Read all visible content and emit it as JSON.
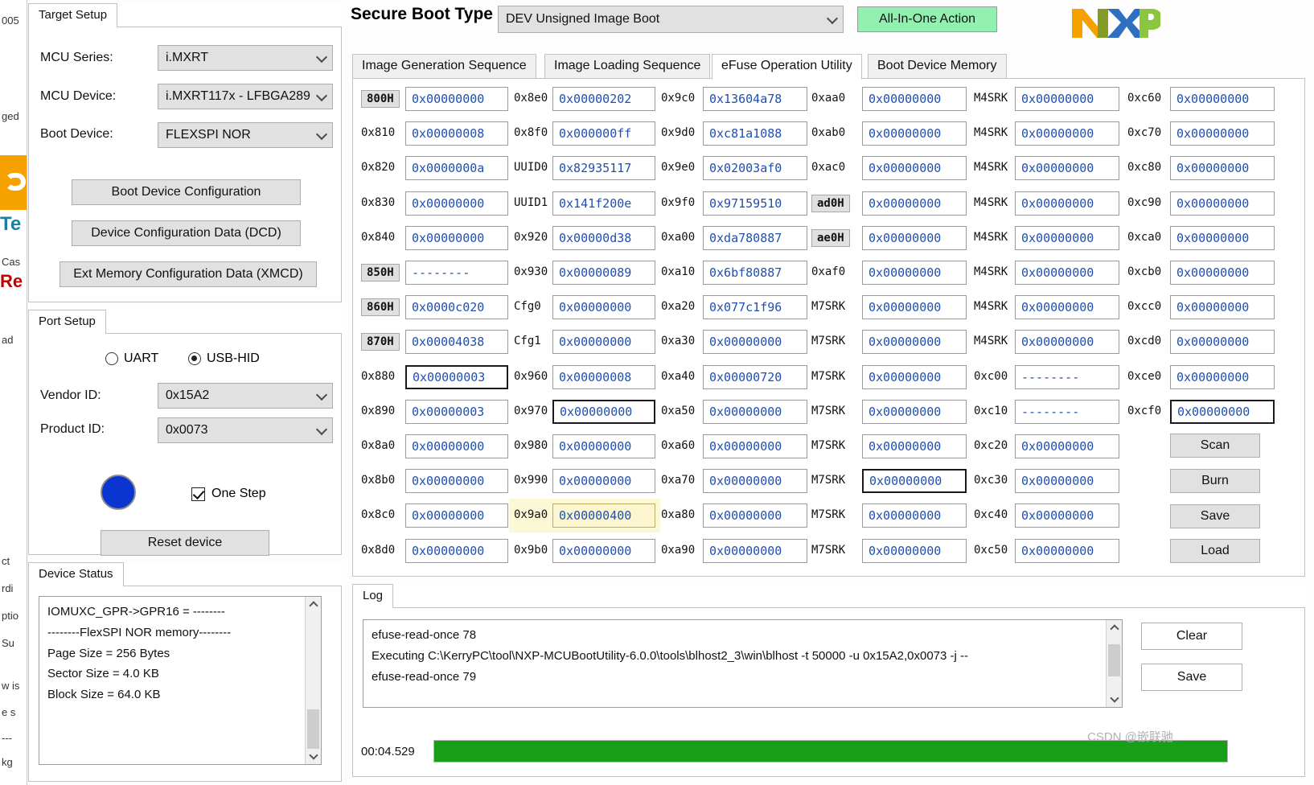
{
  "background_window": {
    "fragments": [
      "005",
      "ged",
      "Te",
      "Cas",
      "Re",
      "ad",
      "ct",
      "rdi",
      "ptio",
      "Su",
      "w is",
      "e s",
      "---",
      "kg"
    ]
  },
  "header": {
    "secure_boot_label": "Secure Boot Type",
    "secure_boot_value": "DEV Unsigned Image Boot",
    "all_in_one_label": "All-In-One Action",
    "all_in_one_color": "#92f0b0",
    "logo_text": "NXP",
    "logo_colors": {
      "orange": "#f5a200",
      "blue": "#2f6fc0",
      "green": "#8cc63f"
    }
  },
  "tabs": [
    {
      "label": "Image Generation Sequence",
      "active": false
    },
    {
      "label": "Image Loading Sequence",
      "active": false
    },
    {
      "label": "eFuse Operation Utility",
      "active": true
    },
    {
      "label": "Boot Device Memory",
      "active": false
    }
  ],
  "target_setup": {
    "title": "Target Setup",
    "mcu_series_label": "MCU Series:",
    "mcu_series_value": "i.MXRT",
    "mcu_device_label": "MCU Device:",
    "mcu_device_value": "i.MXRT117x - LFBGA289",
    "boot_device_label": "Boot Device:",
    "boot_device_value": "FLEXSPI NOR",
    "buttons": [
      "Boot Device Configuration",
      "Device Configuration Data (DCD)",
      "Ext Memory Configuration Data (XMCD)"
    ]
  },
  "port_setup": {
    "title": "Port Setup",
    "uart_label": "UART",
    "usbhid_label": "USB-HID",
    "selected": "USB-HID",
    "vendor_id_label": "Vendor ID:",
    "vendor_id_value": "0x15A2",
    "product_id_label": "Product ID:",
    "product_id_value": "0x0073",
    "one_step_label": "One Step",
    "one_step_checked": true,
    "reset_button": "Reset device",
    "indicator_color": "#0b35d0"
  },
  "device_status": {
    "title": "Device Status",
    "lines": [
      "IOMUXC_GPR->GPR16 = --------",
      "--------FlexSPI NOR memory--------",
      "Page Size   = 256 Bytes",
      "Sector Size = 4.0 KB",
      "Block Size  = 64.0 KB"
    ]
  },
  "efuse": {
    "columns": [
      {
        "rows": [
          {
            "addr": "800H",
            "badge": true,
            "value": "0x00000000"
          },
          {
            "addr": "0x810",
            "badge": false,
            "value": "0x00000008"
          },
          {
            "addr": "0x820",
            "badge": false,
            "value": "0x0000000a"
          },
          {
            "addr": "0x830",
            "badge": false,
            "value": "0x00000000"
          },
          {
            "addr": "0x840",
            "badge": false,
            "value": "0x00000000"
          },
          {
            "addr": "850H",
            "badge": true,
            "value": "--------"
          },
          {
            "addr": "860H",
            "badge": true,
            "value": "0x0000c020"
          },
          {
            "addr": "870H",
            "badge": true,
            "value": "0x00004038"
          },
          {
            "addr": "0x880",
            "badge": false,
            "value": "0x00000003",
            "focus": true
          },
          {
            "addr": "0x890",
            "badge": false,
            "value": "0x00000003"
          },
          {
            "addr": "0x8a0",
            "badge": false,
            "value": "0x00000000"
          },
          {
            "addr": "0x8b0",
            "badge": false,
            "value": "0x00000000"
          },
          {
            "addr": "0x8c0",
            "badge": false,
            "value": "0x00000000"
          },
          {
            "addr": "0x8d0",
            "badge": false,
            "value": "0x00000000"
          }
        ]
      },
      {
        "rows": [
          {
            "addr": "0x8e0",
            "badge": false,
            "value": "0x00000202"
          },
          {
            "addr": "0x8f0",
            "badge": false,
            "value": "0x000000ff"
          },
          {
            "addr": "UUID0",
            "badge": false,
            "value": "0x82935117"
          },
          {
            "addr": "UUID1",
            "badge": false,
            "value": "0x141f200e"
          },
          {
            "addr": "0x920",
            "badge": false,
            "value": "0x00000d38"
          },
          {
            "addr": "0x930",
            "badge": false,
            "value": "0x00000089"
          },
          {
            "addr": "Cfg0",
            "badge": false,
            "value": "0x00000000"
          },
          {
            "addr": "Cfg1",
            "badge": false,
            "value": "0x00000000"
          },
          {
            "addr": "0x960",
            "badge": false,
            "value": "0x00000008"
          },
          {
            "addr": "0x970",
            "badge": false,
            "value": "0x00000000",
            "focus": true
          },
          {
            "addr": "0x980",
            "badge": false,
            "value": "0x00000000"
          },
          {
            "addr": "0x990",
            "badge": false,
            "value": "0x00000000"
          },
          {
            "addr": "0x9a0",
            "badge": false,
            "value": "0x00000400",
            "highlight": true
          },
          {
            "addr": "0x9b0",
            "badge": false,
            "value": "0x00000000"
          }
        ]
      },
      {
        "rows": [
          {
            "addr": "0x9c0",
            "badge": false,
            "value": "0x13604a78"
          },
          {
            "addr": "0x9d0",
            "badge": false,
            "value": "0xc81a1088"
          },
          {
            "addr": "0x9e0",
            "badge": false,
            "value": "0x02003af0"
          },
          {
            "addr": "0x9f0",
            "badge": false,
            "value": "0x97159510"
          },
          {
            "addr": "0xa00",
            "badge": false,
            "value": "0xda780887"
          },
          {
            "addr": "0xa10",
            "badge": false,
            "value": "0x6bf80887"
          },
          {
            "addr": "0xa20",
            "badge": false,
            "value": "0x077c1f96"
          },
          {
            "addr": "0xa30",
            "badge": false,
            "value": "0x00000000"
          },
          {
            "addr": "0xa40",
            "badge": false,
            "value": "0x00000720"
          },
          {
            "addr": "0xa50",
            "badge": false,
            "value": "0x00000000"
          },
          {
            "addr": "0xa60",
            "badge": false,
            "value": "0x00000000"
          },
          {
            "addr": "0xa70",
            "badge": false,
            "value": "0x00000000"
          },
          {
            "addr": "0xa80",
            "badge": false,
            "value": "0x00000000"
          },
          {
            "addr": "0xa90",
            "badge": false,
            "value": "0x00000000"
          }
        ]
      },
      {
        "rows": [
          {
            "addr": "0xaa0",
            "badge": false,
            "value": "0x00000000"
          },
          {
            "addr": "0xab0",
            "badge": false,
            "value": "0x00000000"
          },
          {
            "addr": "0xac0",
            "badge": false,
            "value": "0x00000000"
          },
          {
            "addr": "ad0H",
            "badge": true,
            "value": "0x00000000"
          },
          {
            "addr": "ae0H",
            "badge": true,
            "value": "0x00000000"
          },
          {
            "addr": "0xaf0",
            "badge": false,
            "value": "0x00000000"
          },
          {
            "addr": "M7SRK",
            "badge": false,
            "value": "0x00000000"
          },
          {
            "addr": "M7SRK",
            "badge": false,
            "value": "0x00000000"
          },
          {
            "addr": "M7SRK",
            "badge": false,
            "value": "0x00000000"
          },
          {
            "addr": "M7SRK",
            "badge": false,
            "value": "0x00000000"
          },
          {
            "addr": "M7SRK",
            "badge": false,
            "value": "0x00000000"
          },
          {
            "addr": "M7SRK",
            "badge": false,
            "value": "0x00000000",
            "focus": true
          },
          {
            "addr": "M7SRK",
            "badge": false,
            "value": "0x00000000"
          },
          {
            "addr": "M7SRK",
            "badge": false,
            "value": "0x00000000"
          }
        ]
      },
      {
        "rows": [
          {
            "addr": "M4SRK",
            "badge": false,
            "value": "0x00000000"
          },
          {
            "addr": "M4SRK",
            "badge": false,
            "value": "0x00000000"
          },
          {
            "addr": "M4SRK",
            "badge": false,
            "value": "0x00000000"
          },
          {
            "addr": "M4SRK",
            "badge": false,
            "value": "0x00000000"
          },
          {
            "addr": "M4SRK",
            "badge": false,
            "value": "0x00000000"
          },
          {
            "addr": "M4SRK",
            "badge": false,
            "value": "0x00000000"
          },
          {
            "addr": "M4SRK",
            "badge": false,
            "value": "0x00000000"
          },
          {
            "addr": "M4SRK",
            "badge": false,
            "value": "0x00000000"
          },
          {
            "addr": "0xc00",
            "badge": false,
            "value": "--------"
          },
          {
            "addr": "0xc10",
            "badge": false,
            "value": "--------"
          },
          {
            "addr": "0xc20",
            "badge": false,
            "value": "0x00000000"
          },
          {
            "addr": "0xc30",
            "badge": false,
            "value": "0x00000000"
          },
          {
            "addr": "0xc40",
            "badge": false,
            "value": "0x00000000"
          },
          {
            "addr": "0xc50",
            "badge": false,
            "value": "0x00000000"
          }
        ]
      },
      {
        "rows": [
          {
            "addr": "0xc60",
            "badge": false,
            "value": "0x00000000"
          },
          {
            "addr": "0xc70",
            "badge": false,
            "value": "0x00000000"
          },
          {
            "addr": "0xc80",
            "badge": false,
            "value": "0x00000000"
          },
          {
            "addr": "0xc90",
            "badge": false,
            "value": "0x00000000"
          },
          {
            "addr": "0xca0",
            "badge": false,
            "value": "0x00000000"
          },
          {
            "addr": "0xcb0",
            "badge": false,
            "value": "0x00000000"
          },
          {
            "addr": "0xcc0",
            "badge": false,
            "value": "0x00000000"
          },
          {
            "addr": "0xcd0",
            "badge": false,
            "value": "0x00000000"
          },
          {
            "addr": "0xce0",
            "badge": false,
            "value": "0x00000000"
          },
          {
            "addr": "0xcf0",
            "badge": false,
            "value": "0x00000000",
            "focus": true
          }
        ]
      }
    ],
    "actions": [
      "Scan",
      "Burn",
      "Save",
      "Load"
    ]
  },
  "log": {
    "title": "Log",
    "lines": [
      "efuse-read-once 78",
      "Executing C:\\KerryPC\\tool\\NXP-MCUBootUtility-6.0.0\\tools\\blhost2_3\\win\\blhost -t 50000 -u 0x15A2,0x0073 -j --",
      "efuse-read-once 79"
    ],
    "clear_button": "Clear",
    "save_button": "Save",
    "elapsed": "00:04.529",
    "progress_percent": 100,
    "progress_color": "#17a017"
  },
  "watermark": "CSDN @嵌联驰"
}
